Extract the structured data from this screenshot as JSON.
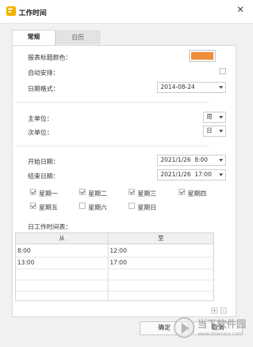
{
  "window": {
    "title": "工作时间",
    "close_glyph": "✕"
  },
  "tabs": [
    {
      "label": "常规",
      "active": true
    },
    {
      "label": "日历",
      "active": false
    }
  ],
  "general": {
    "header_color_label": "报表标题颜色：",
    "header_color": "#ee8d3b",
    "auto_schedule_label": "自动安排：",
    "auto_schedule_checked": false,
    "date_format_label": "日期格式：",
    "date_format_value": "2014-08-24",
    "primary_unit_label": "主单位：",
    "primary_unit_value": "周",
    "secondary_unit_label": "次单位：",
    "secondary_unit_value": "日",
    "start_date_label": "开始日期：",
    "start_date_value": "2021/1/26  8:00",
    "end_date_label": "结束日期：",
    "end_date_value": "2021/1/26  17:00"
  },
  "weekdays": [
    {
      "label": "星期一",
      "checked": true
    },
    {
      "label": "星期二",
      "checked": true
    },
    {
      "label": "星期三",
      "checked": true
    },
    {
      "label": "星期四",
      "checked": true
    },
    {
      "label": "星期五",
      "checked": true
    },
    {
      "label": "星期六",
      "checked": false
    },
    {
      "label": "星期日",
      "checked": false
    }
  ],
  "work_hours": {
    "label": "日工作时间表：",
    "columns": [
      "从",
      "至"
    ],
    "rows": [
      [
        "8:00",
        "12:00"
      ],
      [
        "13:00",
        "17:00"
      ]
    ],
    "add_glyph": "+",
    "remove_glyph": "-"
  },
  "buttons": {
    "ok": "确定",
    "cancel": "取消"
  },
  "watermark": {
    "text": "当下软件园",
    "url": "www.downxia.com"
  }
}
